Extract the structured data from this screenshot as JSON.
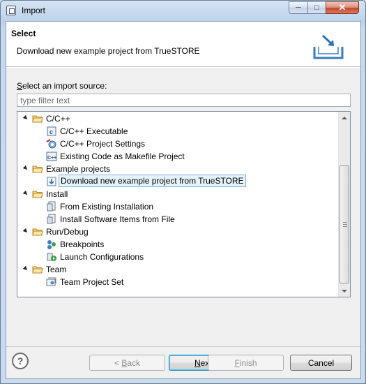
{
  "window": {
    "title": "Import"
  },
  "banner": {
    "title": "Select",
    "message": "Download new example project from TrueSTORE"
  },
  "source": {
    "label_prefix": "S",
    "label_rest": "elect an import source:",
    "filter_placeholder": "type filter text"
  },
  "tree": {
    "items": [
      {
        "label": "C/C++",
        "level": 0,
        "icon": "folder-icon",
        "expanded": true
      },
      {
        "label": "C/C++ Executable",
        "level": 1,
        "icon": "c-executable-icon"
      },
      {
        "label": "C/C++ Project Settings",
        "level": 1,
        "icon": "project-settings-icon"
      },
      {
        "label": "Existing Code as Makefile Project",
        "level": 1,
        "icon": "makefile-project-icon"
      },
      {
        "label": "Example projects",
        "level": 0,
        "icon": "folder-icon",
        "expanded": true
      },
      {
        "label": "Download new example project from TrueSTORE",
        "level": 1,
        "icon": "download-icon",
        "selected": true
      },
      {
        "label": "Install",
        "level": 0,
        "icon": "folder-icon",
        "expanded": true
      },
      {
        "label": "From Existing Installation",
        "level": 1,
        "icon": "installation-icon"
      },
      {
        "label": "Install Software Items from File",
        "level": 1,
        "icon": "install-file-icon"
      },
      {
        "label": "Run/Debug",
        "level": 0,
        "icon": "folder-icon",
        "expanded": true
      },
      {
        "label": "Breakpoints",
        "level": 1,
        "icon": "breakpoints-icon"
      },
      {
        "label": "Launch Configurations",
        "level": 1,
        "icon": "launch-config-icon"
      },
      {
        "label": "Team",
        "level": 0,
        "icon": "folder-icon",
        "expanded": true
      },
      {
        "label": "Team Project Set",
        "level": 1,
        "icon": "team-project-set-icon"
      }
    ]
  },
  "buttons": {
    "back": {
      "prefix": "< ",
      "mnemonic": "B",
      "rest": "ack"
    },
    "next": {
      "mnemonic": "N",
      "rest": "ext >"
    },
    "finish": {
      "mnemonic": "F",
      "rest": "inish"
    },
    "cancel": {
      "label": "Cancel"
    },
    "help": "?"
  },
  "colors": {
    "selection_bg": "#e5f3fb",
    "selection_border": "#84acdd",
    "title_close": "#c6462a"
  }
}
